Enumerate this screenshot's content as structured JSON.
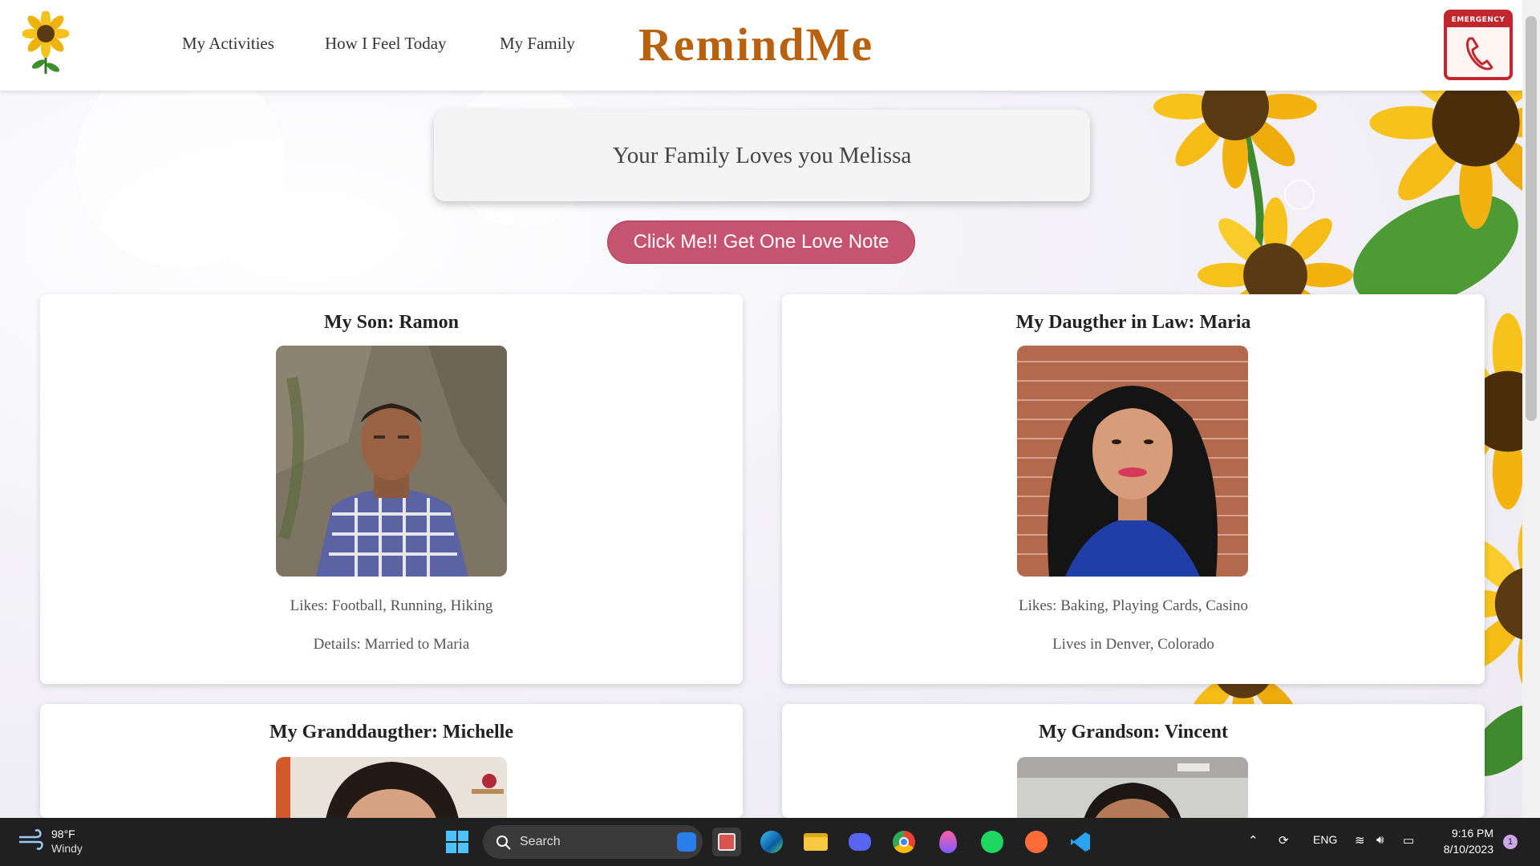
{
  "header": {
    "nav": [
      "My Activities",
      "How I Feel Today",
      "My Family"
    ],
    "brand": "RemindMe",
    "emergency_label": "EMERGENCY"
  },
  "banner": {
    "text": "Your Family Loves you Melissa"
  },
  "love_button": {
    "label": "Click Me!! Get One Love Note"
  },
  "cards": [
    {
      "title": "My Son: Ramon",
      "line1": "Likes: Football, Running, Hiking",
      "line2": "Details: Married to Maria"
    },
    {
      "title": "My Daugther in Law: Maria",
      "line1": "Likes: Baking, Playing Cards, Casino",
      "line2": "Lives in Denver, Colorado"
    },
    {
      "title": "My Granddaugther: Michelle"
    },
    {
      "title": "My Grandson: Vincent"
    }
  ],
  "taskbar": {
    "weather_temp": "98°F",
    "weather_desc": "Windy",
    "search_placeholder": "Search",
    "language": "ENG",
    "time": "9:16 PM",
    "date": "8/10/2023",
    "notification_count": "1"
  },
  "colors": {
    "brand": "#b8610f",
    "button": "#c65370",
    "emergency": "#c1272d"
  }
}
